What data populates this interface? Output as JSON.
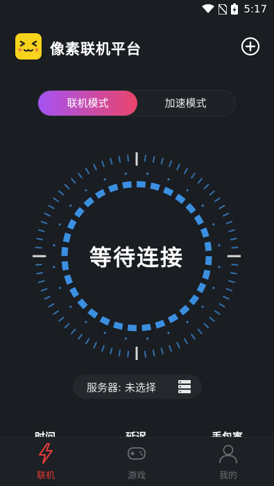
{
  "status_bar": {
    "time": "5:17"
  },
  "app": {
    "title": "像素联机平台",
    "accent": "#f7d31c"
  },
  "mode_toggle": {
    "tabs": [
      {
        "label": "联机模式",
        "active": true
      },
      {
        "label": "加速模式",
        "active": false
      }
    ]
  },
  "connection": {
    "status": "等待连接"
  },
  "server": {
    "label": "服务器: 未选择"
  },
  "stats": {
    "time_label": "时间",
    "latency_label": "延迟",
    "loss_label": "丢包率"
  },
  "nav": {
    "items": [
      {
        "label": "联机",
        "icon": "lightning-icon",
        "active": true
      },
      {
        "label": "游戏",
        "icon": "gamepad-icon",
        "active": false
      },
      {
        "label": "我的",
        "icon": "person-icon",
        "active": false
      }
    ]
  },
  "colors": {
    "dial": "#3b8fe0",
    "active_nav": "#e93b3b",
    "gradient_start": "#a553f3",
    "gradient_end": "#e9456a"
  }
}
